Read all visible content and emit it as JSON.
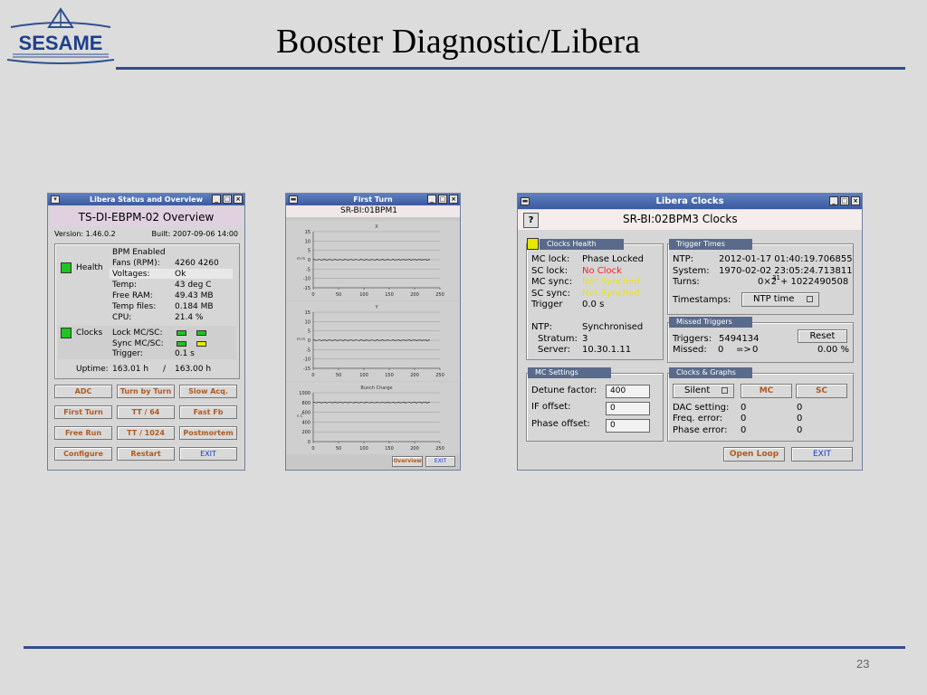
{
  "slide": {
    "title": "Booster Diagnostic/Libera",
    "logo_text": "SESAME",
    "page_number": "23",
    "accent_color": "#2f4f8f"
  },
  "overview_window": {
    "window_title": "Libera Status and Overview",
    "header": "TS-DI-EBPM-02 Overview",
    "version": "Version: 1.46.0.2",
    "built": "Built: 2007-09-06 14:00",
    "health_label": "Health",
    "clocks_label": "Clocks",
    "status_rows": [
      {
        "k": "BPM Enabled",
        "v": ""
      },
      {
        "k": "Fans (RPM):",
        "v": "4260    4260"
      },
      {
        "k": "Voltages:",
        "v": "Ok"
      },
      {
        "k": "Temp:",
        "v": "43 deg C"
      },
      {
        "k": "Free RAM:",
        "v": "49.43 MB"
      },
      {
        "k": "Temp files:",
        "v": "0.184 MB"
      },
      {
        "k": "CPU:",
        "v": "21.4 %"
      }
    ],
    "clock_rows": [
      {
        "k": "Lock MC/SC:"
      },
      {
        "k": "Sync MC/SC:"
      },
      {
        "k": "Trigger:",
        "v": "0.1 s"
      }
    ],
    "uptime_label": "Uptime:",
    "uptime_value": "163.01 h",
    "uptime_sep": "/",
    "uptime_total": "163.00 h",
    "buttons": [
      [
        "ADC",
        "Turn by Turn",
        "Slow Acq."
      ],
      [
        "First Turn",
        "TT / 64",
        "Fast Fb"
      ],
      [
        "Free Run",
        "TT / 1024",
        "Postmortem"
      ],
      [
        "Configure",
        "Restart",
        "EXIT"
      ]
    ]
  },
  "first_turn_window": {
    "window_title": "First Turn",
    "header": "SR-BI:01BPM1",
    "plots": [
      {
        "title": "X",
        "ylabel": "m m",
        "yticks": [
          "15",
          "10",
          "5",
          "0",
          "-5",
          "-10",
          "-15"
        ],
        "xticks": [
          "0",
          "50",
          "100",
          "150",
          "200",
          "250"
        ]
      },
      {
        "title": "Y",
        "ylabel": "m m",
        "yticks": [
          "15",
          "10",
          "5",
          "0",
          "-5",
          "-10",
          "-15"
        ],
        "xticks": [
          "0",
          "50",
          "100",
          "150",
          "200",
          "250"
        ]
      },
      {
        "title": "Bunch Charge",
        "ylabel": "n C",
        "yticks": [
          "1000",
          "800",
          "600",
          "400",
          "200",
          "0"
        ],
        "xticks": [
          "0",
          "50",
          "100",
          "150",
          "200",
          "250"
        ]
      }
    ],
    "overview_button": "Overview",
    "exit_button": "EXIT"
  },
  "clocks_window": {
    "window_title": "Libera Clocks",
    "help_button": "?",
    "header": "SR-BI:02BPM3 Clocks",
    "health": {
      "tab": "Clocks Health",
      "rows": [
        {
          "k": "MC lock:",
          "v": "Phase Locked",
          "color": "#000000"
        },
        {
          "k": "SC lock:",
          "v": "No Clock",
          "color": "#ff2020"
        },
        {
          "k": "MC sync:",
          "v": "Not Synched",
          "color": "#e8e800"
        },
        {
          "k": "SC sync:",
          "v": "Not Synched",
          "color": "#e8e800"
        },
        {
          "k": "Trigger",
          "v": "0.0 s",
          "color": "#000000"
        }
      ],
      "ntp_rows": [
        {
          "k": "NTP:",
          "v": "Synchronised"
        },
        {
          "k": "Stratum:",
          "v": "3"
        },
        {
          "k": "Server:",
          "v": "10.30.1.11"
        }
      ]
    },
    "trigger_times": {
      "tab": "Trigger Times",
      "ntp_label": "NTP:",
      "ntp_value": "2012-01-17 01:40:19.706855",
      "system_label": "System:",
      "system_value": "1970-02-02 23:05:24.713811",
      "turns_label": "Turns:",
      "turns_value_a": "0×2",
      "turns_exp": "31",
      "turns_value_b": "+   1022490508",
      "timestamps_label": "Timestamps:",
      "timestamps_value": "NTP time"
    },
    "missed": {
      "tab": "Missed Triggers",
      "triggers_label": "Triggers:",
      "triggers_value": "5494134",
      "missed_label": "Missed:",
      "missed_value": "0",
      "arrow": "=>",
      "missed_value2": "0",
      "percent": "0.00 %",
      "reset_button": "Reset"
    },
    "mc_settings": {
      "tab": "MC Settings",
      "rows": [
        {
          "k": "Detune factor:",
          "v": "400"
        },
        {
          "k": "IF offset:",
          "v": "0"
        },
        {
          "k": "Phase offset:",
          "v": "0"
        }
      ]
    },
    "clocks_graphs": {
      "tab": "Clocks & Graphs",
      "silent_label": "Silent",
      "mc_button": "MC",
      "sc_button": "SC",
      "rows": [
        {
          "k": "DAC setting:",
          "a": "0",
          "b": "0"
        },
        {
          "k": "Freq. error:",
          "a": "0",
          "b": "0"
        },
        {
          "k": "Phase error:",
          "a": "0",
          "b": "0"
        }
      ]
    },
    "open_loop_button": "Open Loop",
    "exit_button": "EXIT"
  }
}
